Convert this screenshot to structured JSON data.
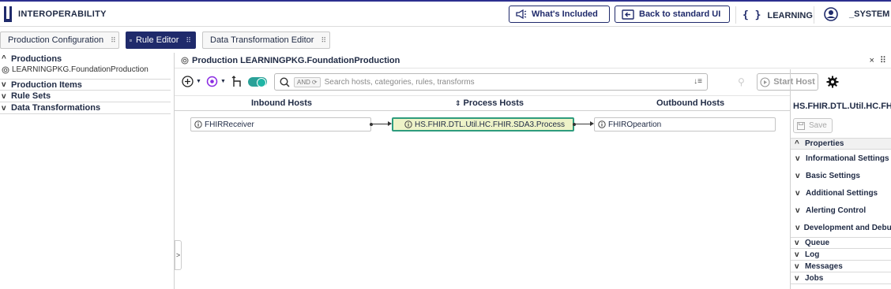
{
  "app": {
    "title": "INTEROPERABILITY",
    "whats_included": "What's Included",
    "back_to_ui": "Back to standard UI",
    "namespace": "LEARNING",
    "user": "_SYSTEM"
  },
  "tabs": [
    {
      "label": "Production Configuration",
      "active": false
    },
    {
      "label": "Rule Editor",
      "active": true
    },
    {
      "label": "Data Transformation Editor",
      "active": false
    }
  ],
  "sidebar": {
    "productions_label": "Productions",
    "production_item": "LEARNINGPKG.FoundationProduction",
    "production_items_label": "Production Items",
    "rule_sets_label": "Rule Sets",
    "data_transformations_label": "Data Transformations",
    "collapse_glyph": ">"
  },
  "production": {
    "title": "Production LEARNINGPKG.FoundationProduction",
    "close": "× ⠿"
  },
  "toolbar": {
    "search_placeholder": "Search hosts, categories, rules, transforms",
    "and_label": "AND",
    "start_host": "Start Host"
  },
  "columns": {
    "inbound": "Inbound Hosts",
    "process": "Process Hosts",
    "outbound": "Outbound Hosts"
  },
  "hosts": {
    "inbound": "FHIRReceiver",
    "process": "HS.FHIR.DTL.Util.HC.FHIR.SDA3.Process",
    "outbound": "FHIROpeartion"
  },
  "details": {
    "host_title": "HS.FHIR.DTL.Util.HC.FHIR.",
    "save_label": "Save",
    "properties": "Properties",
    "informational": "Informational Settings",
    "basic": "Basic Settings",
    "additional": "Additional Settings",
    "alerting": "Alerting Control",
    "development": "Development and Debugging",
    "queue": "Queue",
    "log": "Log",
    "messages": "Messages",
    "jobs": "Jobs"
  },
  "colors": {
    "brand": "#1f2a6b",
    "accent_toggle": "#2aa198",
    "process_border": "#2e9c7d",
    "process_fill": "#eef3c8",
    "namespace_icon": "#8a2be2"
  }
}
